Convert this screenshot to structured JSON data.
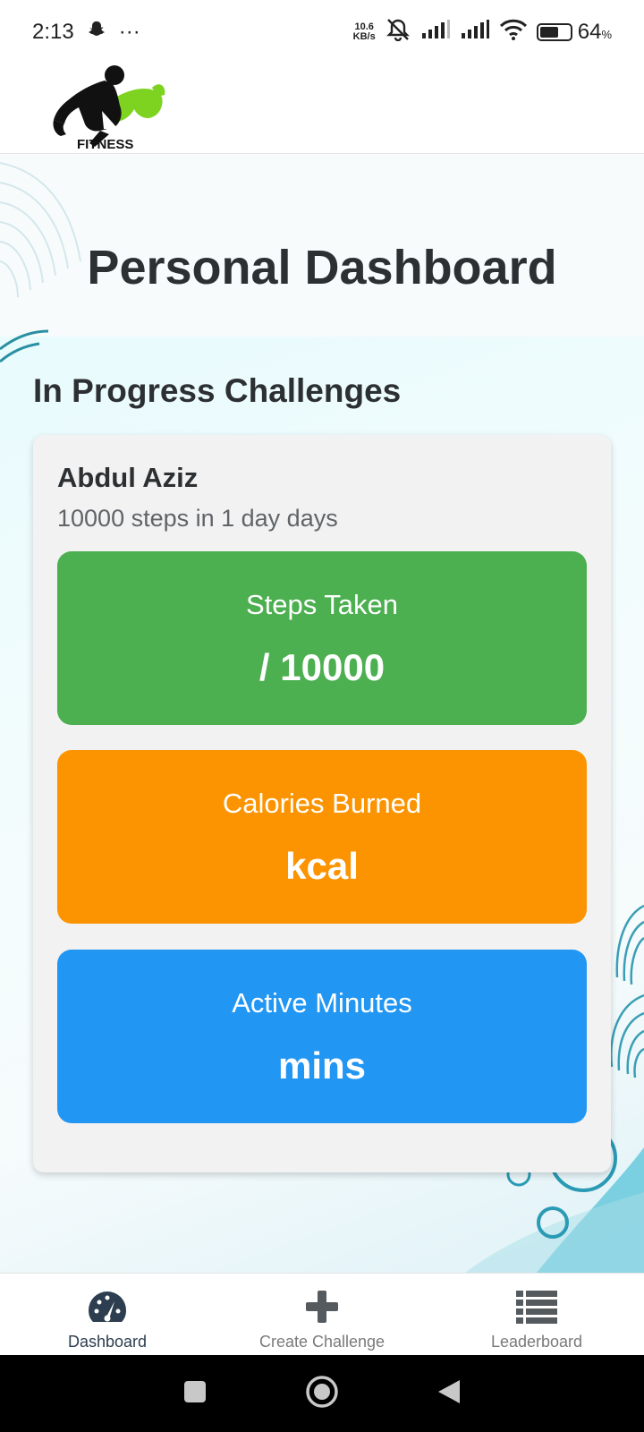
{
  "status_bar": {
    "time": "2:13",
    "more": "···",
    "net_speed_value": "10.6",
    "net_speed_unit": "KB/s",
    "battery_percent": "64",
    "battery_unit": "%",
    "battery_level": 0.64
  },
  "logo": {
    "text": "FITNESS"
  },
  "page": {
    "title": "Personal Dashboard"
  },
  "section": {
    "title": "In Progress Challenges"
  },
  "challenge": {
    "name": "Abdul Aziz",
    "description": "10000 steps in 1 day days",
    "stats": {
      "steps": {
        "label": "Steps Taken",
        "value": "/ 10000",
        "color": "#4caf50"
      },
      "calories": {
        "label": "Calories Burned",
        "value": "kcal",
        "color": "#fb9400"
      },
      "minutes": {
        "label": "Active Minutes",
        "value": "mins",
        "color": "#2196f3"
      }
    }
  },
  "bottom_nav": {
    "items": [
      {
        "label": "Dashboard",
        "icon": "speedometer-icon",
        "active": true
      },
      {
        "label": "Create Challenge",
        "icon": "plus-icon",
        "active": false
      },
      {
        "label": "Leaderboard",
        "icon": "list-icon",
        "active": false
      }
    ]
  },
  "colors": {
    "accent_dark": "#2d3e50",
    "logo_green": "#7ed321"
  }
}
